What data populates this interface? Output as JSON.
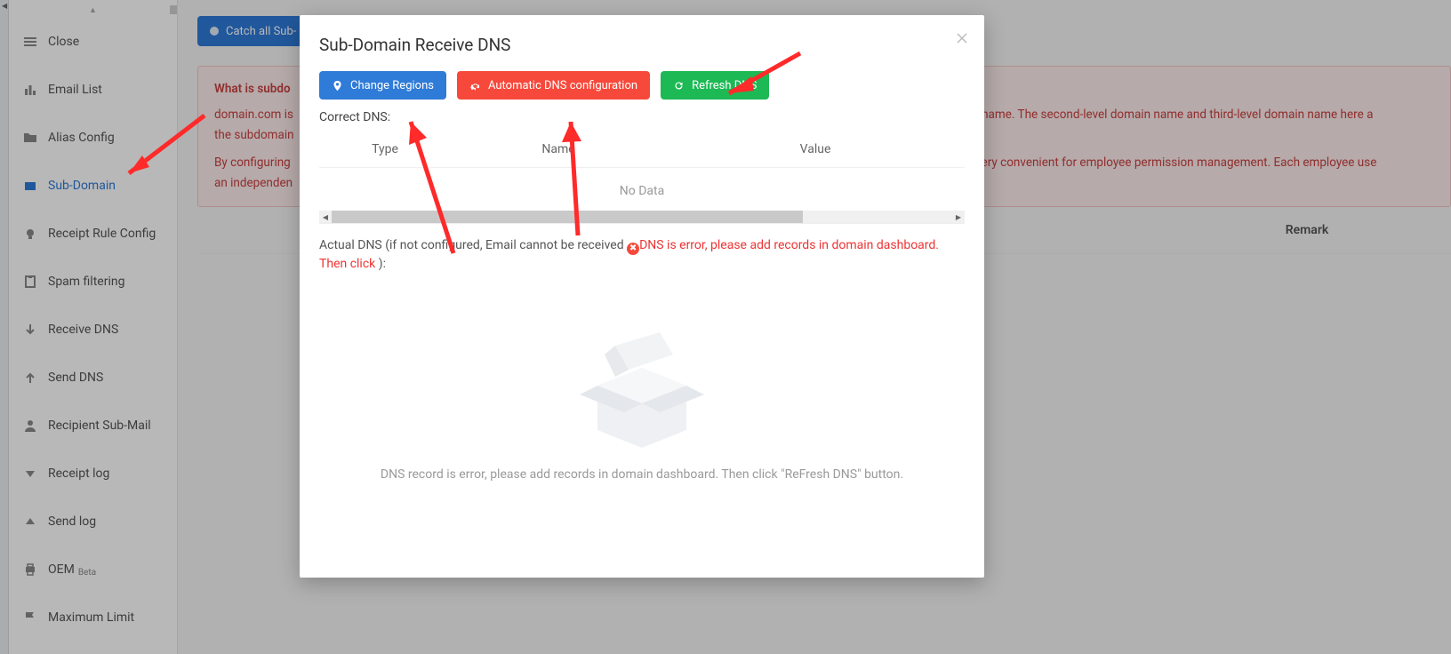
{
  "sidebar": {
    "items": [
      {
        "label": "Close",
        "icon": "close-menu-icon"
      },
      {
        "label": "Email List",
        "icon": "bar-chart-icon"
      },
      {
        "label": "Alias Config",
        "icon": "folder-icon"
      },
      {
        "label": "Sub-Domain",
        "icon": "wallet-icon",
        "active": true
      },
      {
        "label": "Receipt Rule Config",
        "icon": "bulb-icon"
      },
      {
        "label": "Spam filtering",
        "icon": "clipboard-icon"
      },
      {
        "label": "Receive DNS",
        "icon": "arrow-down-icon"
      },
      {
        "label": "Send DNS",
        "icon": "arrow-up-icon"
      },
      {
        "label": "Recipient Sub-Mail",
        "icon": "user-icon"
      },
      {
        "label": "Receipt log",
        "icon": "caret-down-icon"
      },
      {
        "label": "Send log",
        "icon": "caret-up-icon"
      },
      {
        "label": "OEM",
        "icon": "printer-icon",
        "badge": "Beta"
      },
      {
        "label": "Maximum Limit",
        "icon": "flag-icon"
      }
    ]
  },
  "content": {
    "catch_all_button": "Catch all Sub-",
    "info": {
      "title": "What is subdo",
      "line1a": "domain.com is",
      "line1b": "in name. The second-level domain name and third-level domain name here a",
      "line2a": "the subdomain",
      "line3a": "By configuring",
      "line3b": "s very convenient for employee permission management. Each employee use",
      "line4a": "an independen"
    },
    "table_header": "Remark"
  },
  "modal": {
    "title": "Sub-Domain Receive DNS",
    "buttons": {
      "change_regions": "Change Regions",
      "auto_dns": "Automatic DNS configuration",
      "refresh_dns": "Refresh DNS"
    },
    "correct_label": "Correct DNS:",
    "columns": {
      "type": "Type",
      "name": "Name",
      "value": "Value"
    },
    "no_data": "No Data",
    "actual_prefix": "Actual DNS (if not configured, Email cannot be received ",
    "actual_error": "DNS is error, please add records in domain dashboard. Then click ",
    "actual_suffix": "):",
    "empty_message": "DNS record is error, please add records in domain dashboard. Then click \"ReFresh DNS\" button."
  }
}
